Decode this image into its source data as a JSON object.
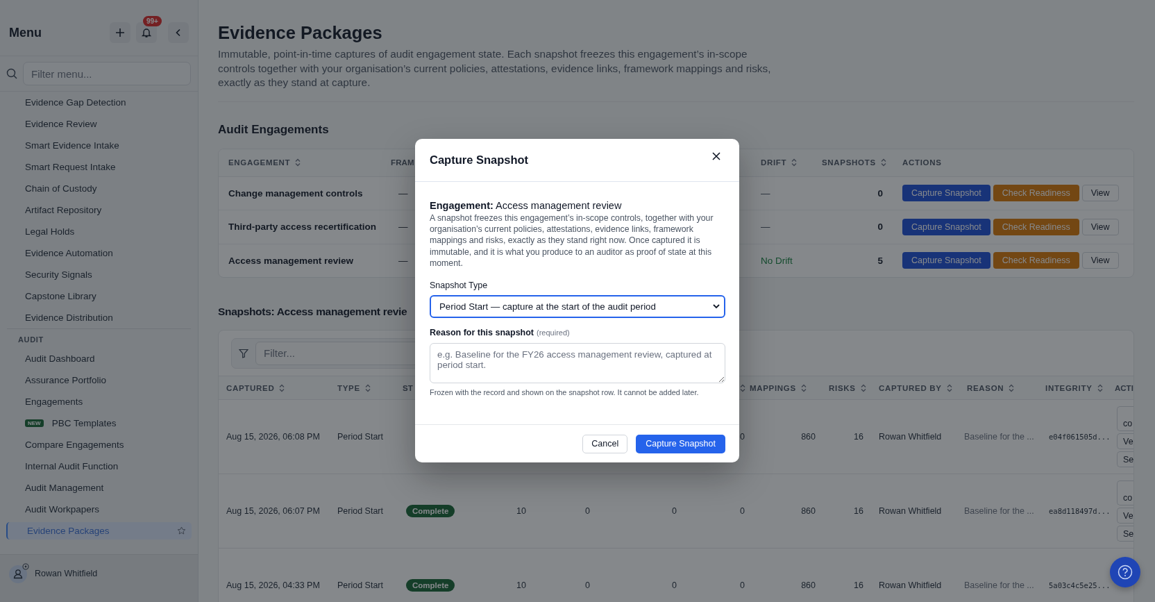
{
  "sidebar": {
    "title": "Menu",
    "notification_count": "99+",
    "filter": {
      "placeholder": "Filter menu..."
    },
    "items": [
      {
        "label": "Evidence Gap Detection",
        "selected": false
      },
      {
        "label": "Evidence Review",
        "selected": false
      },
      {
        "label": "Smart Evidence Intake",
        "selected": false
      },
      {
        "label": "Smart Request Intake",
        "selected": false
      },
      {
        "label": "Chain of Custody",
        "selected": false
      },
      {
        "label": "Artifact Repository",
        "selected": false
      },
      {
        "label": "Legal Holds",
        "selected": false
      },
      {
        "label": "Evidence Automation",
        "selected": false
      },
      {
        "label": "Security Signals",
        "selected": false
      },
      {
        "label": "Capstone Library",
        "selected": false
      },
      {
        "label": "Evidence Distribution",
        "selected": false
      }
    ],
    "sections": [
      {
        "heading": "AUDIT",
        "items": [
          {
            "label": "Audit Dashboard",
            "selected": false
          },
          {
            "label": "Assurance Portfolio",
            "selected": false
          },
          {
            "label": "Engagements",
            "selected": false
          },
          {
            "label": "PBC Templates",
            "badge": "NEW",
            "selected": false
          },
          {
            "label": "Compare Engagements",
            "selected": false
          },
          {
            "label": "Internal Audit Function",
            "selected": false
          },
          {
            "label": "Audit Management",
            "selected": false
          },
          {
            "label": "Audit Workpapers",
            "selected": false
          },
          {
            "label": "Evidence Packages",
            "selected": true
          }
        ]
      }
    ],
    "user": {
      "name": "Rowan Whitfield"
    }
  },
  "page": {
    "title": "Evidence Packages",
    "description": "Immutable, point-in-time captures of audit engagement state. Each snapshot freezes this engagement’s in-scope controls together with your organisation’s current policies, attestations, evidence links, framework mappings and risks, exactly as they stand at capture.",
    "engagements": {
      "title": "Audit Engagements",
      "columns": [
        {
          "label": "ENGAGEMENT",
          "sortable": true
        },
        {
          "label": "FRAM",
          "sortable": false
        },
        {
          "label": "DRIFT",
          "sortable": true
        },
        {
          "label": "SNAPSHOTS",
          "sortable": true
        },
        {
          "label": "ACTIONS",
          "sortable": false
        }
      ],
      "rows": [
        {
          "engagement": "Change management controls",
          "framework": "—",
          "drift": {
            "text": "—",
            "kind": "none"
          },
          "snapshots": "0",
          "actions": [
            {
              "label": "Capture Snapshot",
              "kind": "primary"
            },
            {
              "label": "Check Readiness",
              "kind": "warning"
            },
            {
              "label": "View",
              "kind": "secondary"
            }
          ]
        },
        {
          "engagement": "Third-party access recertification",
          "framework": "—",
          "drift": {
            "text": "—",
            "kind": "none"
          },
          "snapshots": "0",
          "actions": [
            {
              "label": "Capture Snapshot",
              "kind": "primary"
            },
            {
              "label": "Check Readiness",
              "kind": "warning"
            },
            {
              "label": "View",
              "kind": "secondary"
            }
          ]
        },
        {
          "engagement": "Access management review",
          "framework": "—",
          "drift": {
            "text": "No Drift",
            "kind": "ok"
          },
          "snapshots": "5",
          "actions": [
            {
              "label": "Capture Snapshot",
              "kind": "primary"
            },
            {
              "label": "Check Readiness",
              "kind": "warning"
            },
            {
              "label": "View",
              "kind": "secondary"
            }
          ]
        }
      ]
    },
    "snapshots": {
      "title": "Snapshots: Access management revie",
      "filter": {
        "placeholder": "Filter..."
      },
      "columns": [
        {
          "label": "CAPTURED",
          "sortable": true
        },
        {
          "label": "TYPE",
          "sortable": true
        },
        {
          "label": "ST",
          "sortable": false
        },
        {
          "sortable": true
        },
        {
          "label": "MAPPINGS",
          "sortable": true
        },
        {
          "label": "RISKS",
          "sortable": true
        },
        {
          "label": "CAPTURED BY",
          "sortable": true
        },
        {
          "label": "REASON",
          "sortable": true
        },
        {
          "label": "INTEGRITY",
          "sortable": true
        },
        {
          "label": "ACTI",
          "sortable": false
        }
      ],
      "rows": [
        {
          "captured": "Aug 15, 2026, 06:08 PM",
          "type": "Period Start",
          "column_7": "0",
          "mappings": "860",
          "risks": "16",
          "captured_by": "Rowan Whitfield",
          "reason": "Baseline for the ...",
          "integrity": "e04f061505d...",
          "actions": [
            "co",
            "Ve",
            "Se"
          ]
        },
        {
          "captured": "Aug 15, 2026, 06:07 PM",
          "type": "Period Start",
          "status": "Complete",
          "column_4": "10",
          "column_5": "0",
          "column_6": "0",
          "column_7": "0",
          "mappings": "860",
          "risks": "16",
          "captured_by": "Rowan Whitfield",
          "reason": "Baseline for the ...",
          "integrity": "ea8d118497d...",
          "actions": [
            "co",
            "Ve",
            "Se"
          ]
        },
        {
          "captured": "Aug 15, 2026, 04:33 PM",
          "type": "Period Start",
          "status": "Complete",
          "column_4": "10",
          "column_5": "0",
          "column_6": "0",
          "column_7": "0",
          "mappings": "860",
          "risks": "16",
          "captured_by": "Rowan Whitfield",
          "reason": "Baseline for the ...",
          "integrity": "5a03c4c5e25..."
        }
      ]
    }
  },
  "modal": {
    "title": "Capture Snapshot",
    "engagement": "**Engagement:** Access management review",
    "description": "A snapshot freezes this engagement’s in-scope controls, together with your organisation’s current policies, attestations, evidence links, framework mappings and risks, exactly as they stand right now. Once captured it is immutable, and it is what you produce to an auditor as proof of state at this moment.",
    "type_label": "Snapshot Type",
    "type_value": "Period Start — capture at the start of the audit period",
    "reason_label": "Reason for this snapshot",
    "reason_note": "(required)",
    "reason_placeholder": "e.g. Baseline for the FY26 access management review, captured at period start.",
    "helper": "Frozen with the record and shown on the snapshot row. It cannot be added later.",
    "buttons": [
      {
        "label": "Cancel",
        "kind": "secondary"
      },
      {
        "label": "Capture Snapshot",
        "kind": "primary"
      }
    ]
  }
}
